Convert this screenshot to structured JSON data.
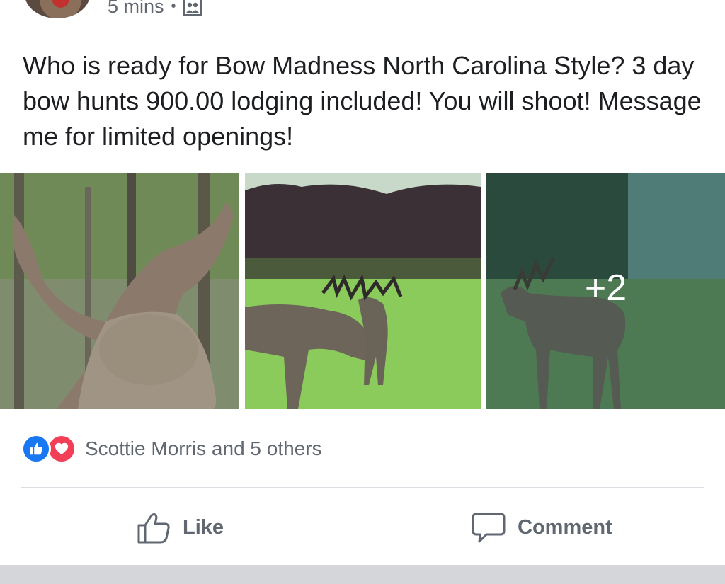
{
  "post": {
    "time": "5 mins",
    "separator": "•",
    "audience_icon": "friends-audience-icon",
    "text": "Who is ready for Bow Madness North Carolina Style? 3 day bow hunts 900.00 lodging included! You will shoot! Message me for limited openings!",
    "photos": [
      {
        "icon": "deer-photo"
      },
      {
        "icon": "deer-photo"
      },
      {
        "icon": "deer-photo",
        "more_count": "+2"
      }
    ]
  },
  "reactions": {
    "icons": [
      "like-reaction-icon",
      "love-reaction-icon"
    ],
    "summary": "Scottie Morris and 5 others"
  },
  "actions": {
    "like_label": "Like",
    "comment_label": "Comment"
  },
  "colors": {
    "like_blue": "#1877f2",
    "love_red": "#f33e58",
    "text_secondary": "#606770",
    "divider": "#dadde1"
  }
}
